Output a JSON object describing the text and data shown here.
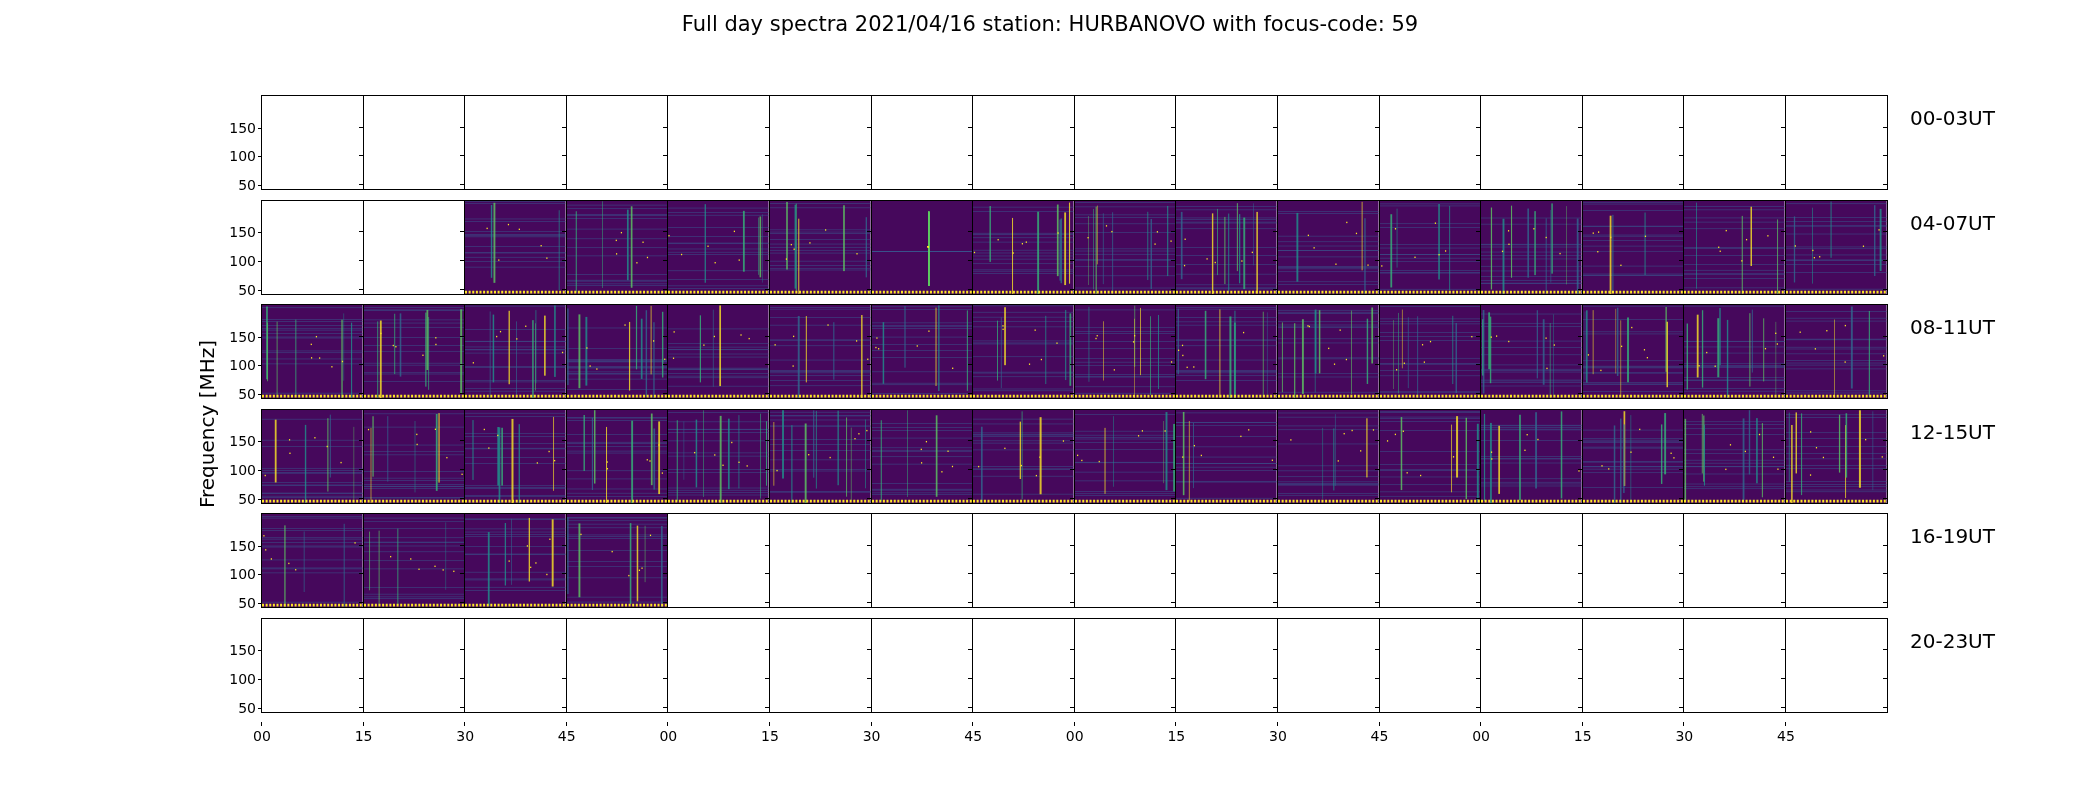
{
  "title": "Full day spectra 2021/04/16 station: HURBANOVO with focus-code: 59",
  "ylabel": "Frequency [MHz]",
  "xticks": [
    "00",
    "15",
    "30",
    "45",
    "00",
    "15",
    "30",
    "45",
    "00",
    "15",
    "30",
    "45",
    "00",
    "15",
    "30",
    "45"
  ],
  "rows": [
    {
      "label": "00-03UT",
      "yticks": [
        "150",
        "100",
        "50"
      ],
      "panels": [
        {
          "has_data": false
        },
        {
          "has_data": false
        },
        {
          "has_data": false
        },
        {
          "has_data": false
        },
        {
          "has_data": false
        },
        {
          "has_data": false
        },
        {
          "has_data": false
        },
        {
          "has_data": false
        },
        {
          "has_data": false
        },
        {
          "has_data": false
        },
        {
          "has_data": false
        },
        {
          "has_data": false
        },
        {
          "has_data": false
        },
        {
          "has_data": false
        },
        {
          "has_data": false
        },
        {
          "has_data": false
        }
      ]
    },
    {
      "label": "04-07UT",
      "yticks": [
        "150",
        "100",
        "50"
      ],
      "panels": [
        {
          "has_data": false
        },
        {
          "has_data": false
        },
        {
          "has_data": true
        },
        {
          "has_data": true
        },
        {
          "has_data": true
        },
        {
          "has_data": true
        },
        {
          "has_data": true
        },
        {
          "has_data": true
        },
        {
          "has_data": true
        },
        {
          "has_data": true
        },
        {
          "has_data": true
        },
        {
          "has_data": true
        },
        {
          "has_data": true
        },
        {
          "has_data": true
        },
        {
          "has_data": true
        },
        {
          "has_data": true
        }
      ]
    },
    {
      "label": "08-11UT",
      "yticks": [
        "150",
        "100",
        "50"
      ],
      "panels": [
        {
          "has_data": true
        },
        {
          "has_data": true
        },
        {
          "has_data": true
        },
        {
          "has_data": true
        },
        {
          "has_data": true
        },
        {
          "has_data": true
        },
        {
          "has_data": true
        },
        {
          "has_data": true
        },
        {
          "has_data": true
        },
        {
          "has_data": true
        },
        {
          "has_data": true
        },
        {
          "has_data": true
        },
        {
          "has_data": true
        },
        {
          "has_data": true
        },
        {
          "has_data": true
        },
        {
          "has_data": true
        }
      ]
    },
    {
      "label": "12-15UT",
      "yticks": [
        "150",
        "100",
        "50"
      ],
      "panels": [
        {
          "has_data": true
        },
        {
          "has_data": true
        },
        {
          "has_data": true
        },
        {
          "has_data": true
        },
        {
          "has_data": true
        },
        {
          "has_data": true
        },
        {
          "has_data": true
        },
        {
          "has_data": true
        },
        {
          "has_data": true
        },
        {
          "has_data": true
        },
        {
          "has_data": true
        },
        {
          "has_data": true
        },
        {
          "has_data": true
        },
        {
          "has_data": true
        },
        {
          "has_data": true
        },
        {
          "has_data": true
        }
      ]
    },
    {
      "label": "16-19UT",
      "yticks": [
        "150",
        "100",
        "50"
      ],
      "panels": [
        {
          "has_data": true
        },
        {
          "has_data": true
        },
        {
          "has_data": true
        },
        {
          "has_data": true
        },
        {
          "has_data": false
        },
        {
          "has_data": false
        },
        {
          "has_data": false
        },
        {
          "has_data": false
        },
        {
          "has_data": false
        },
        {
          "has_data": false
        },
        {
          "has_data": false
        },
        {
          "has_data": false
        },
        {
          "has_data": false
        },
        {
          "has_data": false
        },
        {
          "has_data": false
        },
        {
          "has_data": false
        }
      ]
    },
    {
      "label": "20-23UT",
      "yticks": [
        "150",
        "100",
        "50"
      ],
      "panels": [
        {
          "has_data": false
        },
        {
          "has_data": false
        },
        {
          "has_data": false
        },
        {
          "has_data": false
        },
        {
          "has_data": false
        },
        {
          "has_data": false
        },
        {
          "has_data": false
        },
        {
          "has_data": false
        },
        {
          "has_data": false
        },
        {
          "has_data": false
        },
        {
          "has_data": false
        },
        {
          "has_data": false
        },
        {
          "has_data": false
        },
        {
          "has_data": false
        },
        {
          "has_data": false
        },
        {
          "has_data": false
        }
      ]
    }
  ]
}
